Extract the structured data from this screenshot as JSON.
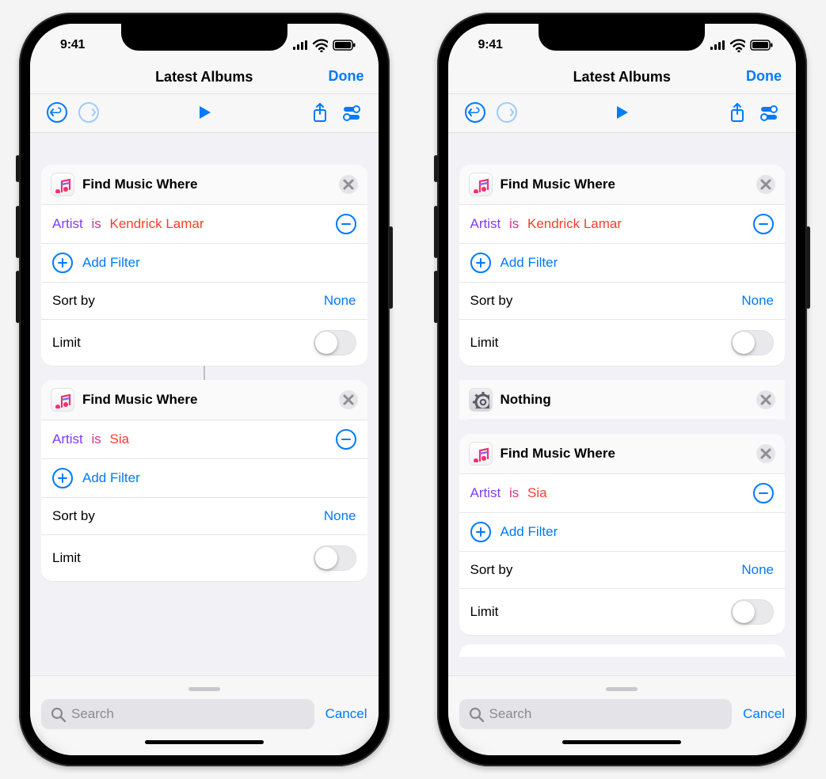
{
  "status": {
    "time": "9:41"
  },
  "nav": {
    "title": "Latest Albums",
    "done": "Done"
  },
  "labels": {
    "add_filter": "Add Filter",
    "sort_by": "Sort by",
    "sort_value": "None",
    "limit": "Limit",
    "search_placeholder": "Search",
    "cancel": "Cancel"
  },
  "left": {
    "cards": [
      {
        "title": "Find Music Where",
        "artist_label": "Artist",
        "is_label": "is",
        "artist_value": "Kendrick Lamar"
      },
      {
        "title": "Find Music Where",
        "artist_label": "Artist",
        "is_label": "is",
        "artist_value": "Sia"
      }
    ]
  },
  "right": {
    "cards": [
      {
        "title": "Find Music Where",
        "artist_label": "Artist",
        "is_label": "is",
        "artist_value": "Kendrick Lamar"
      },
      {
        "title": "Find Music Where",
        "artist_label": "Artist",
        "is_label": "is",
        "artist_value": "Sia"
      }
    ],
    "middle_action": {
      "title": "Nothing"
    }
  }
}
